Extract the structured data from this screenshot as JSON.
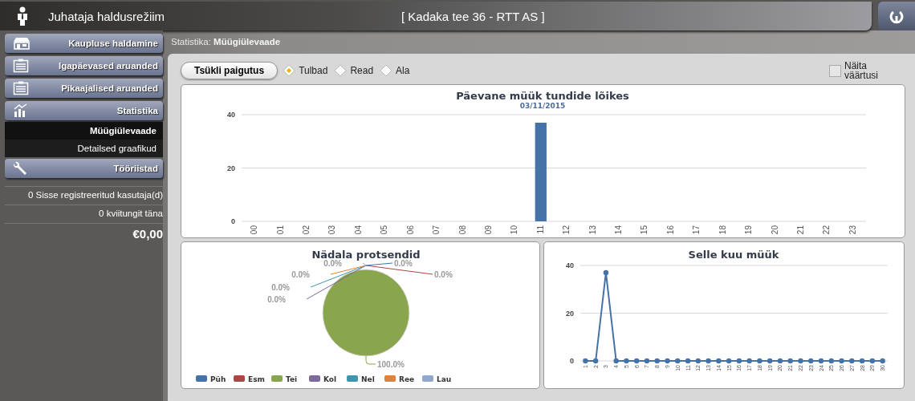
{
  "header": {
    "title": "Juhataja haldusrežiim",
    "store": "[  Kadaka tee 36  -  RTT AS  ]"
  },
  "sidebar": {
    "items": [
      {
        "kind": "button",
        "label": "Kaupluse haldamine"
      },
      {
        "kind": "button",
        "label": "Igapäevased aruanded"
      },
      {
        "kind": "button",
        "label": "Pikaajalised aruanded"
      },
      {
        "kind": "button",
        "label": "Statistika"
      },
      {
        "kind": "subitem",
        "label": "Müügiülevaade",
        "selected": true
      },
      {
        "kind": "subitem",
        "label": "Detailsed graafikud",
        "selected": false
      },
      {
        "kind": "button",
        "label": "Tööriistad"
      }
    ],
    "stats": [
      "0 Sisse registreeritud kasutaja(d)",
      "0 kviitungit täna"
    ],
    "total": "€0,00"
  },
  "breadcrumb": {
    "section": "Statistika:",
    "page": "Müügiülevaade"
  },
  "toolbar": {
    "button": "Tsükli paigutus",
    "options": [
      {
        "label": "Tulbad",
        "selected": true
      },
      {
        "label": "Read",
        "selected": false
      },
      {
        "label": "Ala",
        "selected": false
      }
    ],
    "show_values": {
      "label": "Näita väärtusi",
      "checked": false
    }
  },
  "hourly": {
    "subtitle": "03/11/2015",
    "chart_data": {
      "type": "bar",
      "title": "Päevane müük tundide lõikes",
      "categories": [
        "00",
        "01",
        "02",
        "03",
        "04",
        "05",
        "06",
        "07",
        "08",
        "09",
        "10",
        "11",
        "12",
        "13",
        "14",
        "15",
        "16",
        "17",
        "18",
        "19",
        "20",
        "21",
        "22",
        "23"
      ],
      "values": [
        0,
        0,
        0,
        0,
        0,
        0,
        0,
        0,
        0,
        0,
        0,
        37,
        0,
        0,
        0,
        0,
        0,
        0,
        0,
        0,
        0,
        0,
        0,
        0
      ],
      "ylim": [
        0,
        40
      ],
      "yticks": [
        0,
        20,
        40
      ]
    }
  },
  "weekly": {
    "chart_data": {
      "type": "pie",
      "title": "Nädala protsendid",
      "categories": [
        "Püh",
        "Esm",
        "Tei",
        "Kol",
        "Nel",
        "Ree",
        "Lau"
      ],
      "values": [
        0,
        0,
        100,
        0,
        0,
        0,
        0
      ],
      "colors": [
        "#4572a7",
        "#aa4643",
        "#89a54e",
        "#80699b",
        "#3d96ae",
        "#db843d",
        "#92a8cd"
      ],
      "value_labels": [
        "0.0%",
        "0.0%",
        "100.0%",
        "0.0%",
        "0.0%",
        "0.0%",
        "0.0%"
      ]
    }
  },
  "monthly": {
    "chart_data": {
      "type": "line",
      "title": "Selle kuu müük",
      "categories": [
        "1",
        "2",
        "3",
        "4",
        "5",
        "6",
        "7",
        "8",
        "9",
        "10",
        "11",
        "12",
        "13",
        "14",
        "15",
        "16",
        "17",
        "18",
        "19",
        "20",
        "21",
        "22",
        "23",
        "24",
        "25",
        "26",
        "27",
        "28",
        "29",
        "30"
      ],
      "series": [
        {
          "color": "#4572a7",
          "marker": true,
          "values": [
            0,
            0,
            37,
            0,
            0,
            0,
            0,
            0,
            0,
            0,
            0,
            0,
            0,
            0,
            0,
            0,
            0,
            0,
            0,
            0,
            0,
            0,
            0,
            0,
            0,
            0,
            0,
            0,
            0,
            0
          ]
        }
      ],
      "ylim": [
        0,
        40
      ],
      "yticks": [
        0,
        20,
        40
      ]
    }
  }
}
